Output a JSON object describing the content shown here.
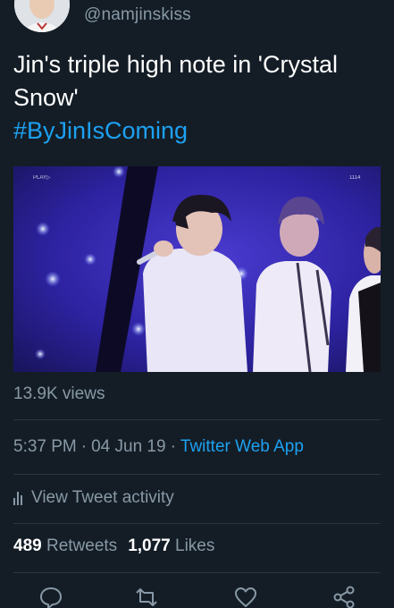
{
  "header": {
    "handle": "@namjinskiss",
    "avatar_icon": "user-avatar"
  },
  "tweet": {
    "text": "Jin's triple high note in 'Crystal Snow'",
    "hashtag": "#ByJinIsComing"
  },
  "media": {
    "overlay_left": "PLAY▷",
    "overlay_right": "1114"
  },
  "stats": {
    "views": "13.9K views",
    "time": "5:37 PM",
    "separator": "·",
    "date": "04 Jun 19",
    "app": "Twitter Web App",
    "activity_label": "View Tweet activity",
    "retweets_count": "489",
    "retweets_label": "Retweets",
    "likes_count": "1,077",
    "likes_label": "Likes"
  },
  "actions": {
    "icons": [
      "reply-icon",
      "retweet-icon",
      "like-icon",
      "share-icon"
    ]
  },
  "colors": {
    "background": "#141d26",
    "secondary_text": "#8899a6",
    "accent": "#1da1f2"
  }
}
